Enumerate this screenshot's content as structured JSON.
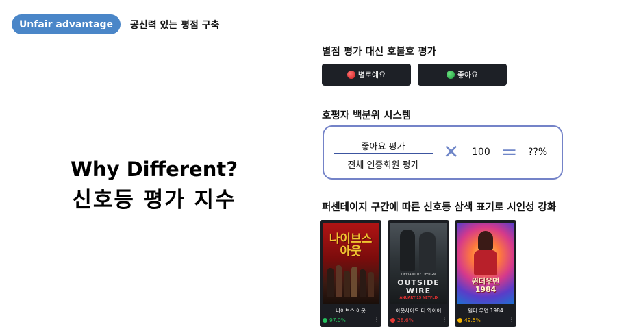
{
  "header": {
    "badge": "Unfair advantage",
    "subtitle": "공신력 있는 평점 구축"
  },
  "hero": {
    "line1": "Why Different?",
    "line2": "신호등 평가 지수"
  },
  "vote": {
    "title": "별점 평가 대신 호불호 평가",
    "dislike_label": "별로예요",
    "like_label": "좋아요",
    "colors": {
      "dislike": "#d01e1e",
      "like": "#1fa040"
    }
  },
  "formula": {
    "title": "호평자 백분위 시스템",
    "numerator": "좋아요 평가",
    "denominator": "전체 인증회원 평가",
    "multiplier": "100",
    "result": "??%",
    "accent": "#7483c8"
  },
  "cards": {
    "title": "퍼센테이지 구간에 따른 신호등 삼색 표기로 시인성 강화",
    "items": [
      {
        "title": "나이브스 아웃",
        "score": "97.0%",
        "score_color": "#25c25c",
        "poster": {
          "text": "나이브스\n아웃",
          "icon": "poster-knives-out"
        }
      },
      {
        "title": "아웃사이드 더 와이어",
        "score": "28.6%",
        "score_color": "#e53935",
        "poster": {
          "text": "OUTSIDE\nWIRE",
          "extra_top": "DEFIANT BY DESIGN",
          "extra_bottom": "JANUARY 15  NETFLIX",
          "icon": "poster-outside-the-wire"
        }
      },
      {
        "title": "원더 우먼 1984",
        "score": "49.5%",
        "score_color": "#f5b400",
        "poster": {
          "text": "원더우먼\n1984",
          "icon": "poster-wonder-woman"
        }
      }
    ]
  }
}
